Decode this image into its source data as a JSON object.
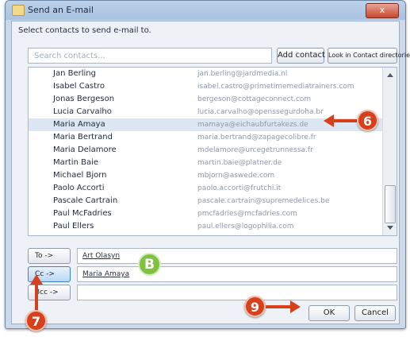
{
  "window": {
    "title": "Send an E-mail",
    "close_label": "x"
  },
  "instruction": "Select contacts to send e-mail to.",
  "search": {
    "placeholder": "Search contacts..."
  },
  "toolbar": {
    "add_contact": "Add contact",
    "look_in_directories": "Look in Contact directories"
  },
  "contacts": [
    {
      "name": "Jan Berling",
      "email": "jan.berling@jardmedia.nl"
    },
    {
      "name": "Isabel Castro",
      "email": "isabel.castro@primetimemediatrainers.com"
    },
    {
      "name": "Jonas Bergeson",
      "email": "bergeson@cottageconnect.com"
    },
    {
      "name": "Lucia Carvalho",
      "email": "lucia.carvalho@openssegurdoha.br"
    },
    {
      "name": "Maria Amaya",
      "email": "mamaya@eichaubfurtakezs.de"
    },
    {
      "name": "Maria Bertrand",
      "email": "maria.bertrand@zapagecolibre.fr"
    },
    {
      "name": "Maria Delamore",
      "email": "mdelamore@urcegetrunnessa.fr"
    },
    {
      "name": "Martin Baie",
      "email": "martin.baie@platner.de"
    },
    {
      "name": "Michael Bjorn",
      "email": "mbjorn@aswede.com"
    },
    {
      "name": "Paolo Accorti",
      "email": "paolo.accorti@frutchi.it"
    },
    {
      "name": "Pascale Cartrain",
      "email": "pascale.cartrain@supremedelices.be"
    },
    {
      "name": "Paul McFadries",
      "email": "pmcfadries@mcfadries.com"
    },
    {
      "name": "Paul Ellers",
      "email": "paul.ellers@logophilia.com"
    }
  ],
  "selected_index": 4,
  "fields": {
    "to": {
      "label": "To ->",
      "value": "Art Olasyn"
    },
    "cc": {
      "label": "Cc ->",
      "value": "Maria Amaya"
    },
    "bcc": {
      "label": "Bcc ->",
      "value": ""
    }
  },
  "actions": {
    "ok": "OK",
    "cancel": "Cancel"
  },
  "callouts": {
    "six": "6",
    "b": "B",
    "seven": "7",
    "nine": "9"
  },
  "colors": {
    "callout_red": "#d6401d",
    "callout_green": "#7dc242",
    "selection": "#dce7f3"
  }
}
